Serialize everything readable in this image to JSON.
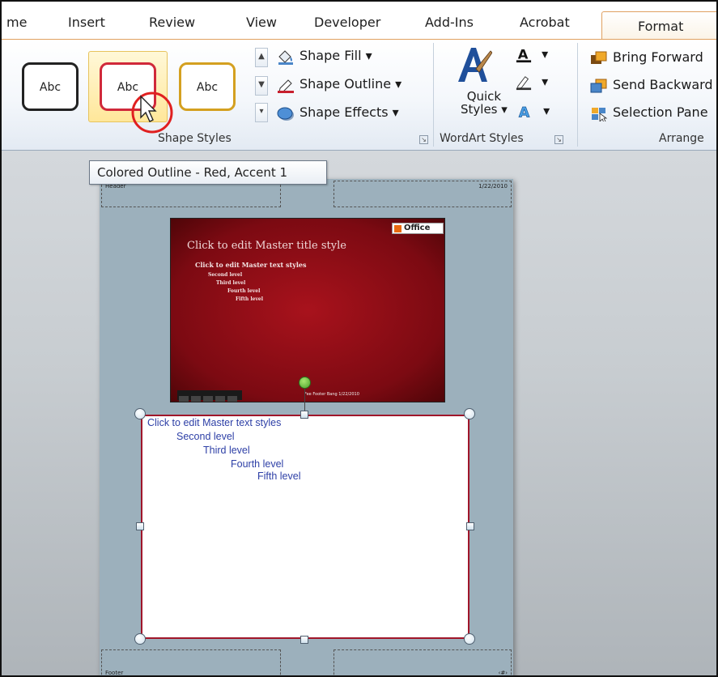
{
  "tabs": [
    {
      "label": "me"
    },
    {
      "label": "Insert"
    },
    {
      "label": "Review"
    },
    {
      "label": "View"
    },
    {
      "label": "Developer"
    },
    {
      "label": "Add-Ins"
    },
    {
      "label": "Acrobat"
    }
  ],
  "active_tab": {
    "label": "Format"
  },
  "shape_styles": {
    "group_label": "Shape Styles",
    "thumbnails": [
      {
        "label": "Abc",
        "outline_color": "#222222"
      },
      {
        "label": "Abc",
        "outline_color": "#d0293a"
      },
      {
        "label": "Abc",
        "outline_color": "#d4a020"
      }
    ],
    "hovered_index": 1,
    "fill_label": "Shape Fill",
    "outline_label": "Shape Outline",
    "effects_label": "Shape Effects"
  },
  "wordart_styles": {
    "group_label": "WordArt Styles",
    "quick_styles_label": "Quick",
    "quick_styles_label2": "Styles"
  },
  "arrange": {
    "group_label": "Arrange",
    "bring_forward_label": "Bring Forward",
    "send_backward_label": "Send Backward",
    "selection_pane_label": "Selection Pane"
  },
  "tooltip": {
    "text": "Colored Outline - Red, Accent 1"
  },
  "page": {
    "header_label": "Header",
    "date_label": "1/22/2010",
    "footer_label": "Footer",
    "page_num_label": "‹#›"
  },
  "slide": {
    "title": "Click to edit Master title style",
    "level1": "Click to edit Master text styles",
    "level2": "Second level",
    "level3": "Third level",
    "level4": "Fourth level",
    "level5": "Fifth level",
    "logo": "Office",
    "footer": "Fee Footer Bang   1/22/2010"
  },
  "notes": {
    "level1": "Click to edit Master text styles",
    "level2": "Second level",
    "level3": "Third level",
    "level4": "Fourth level",
    "level5": "Fifth level"
  },
  "colors": {
    "accent_red": "#d0293a",
    "annotation_circle": "#e02020",
    "notes_text": "#2d3fa6"
  },
  "icons": [
    "shape-fill-icon",
    "shape-outline-icon",
    "shape-effects-icon",
    "quick-styles-icon",
    "text-fill-icon",
    "text-outline-icon",
    "text-effects-icon",
    "bring-forward-icon",
    "send-backward-icon",
    "selection-pane-icon",
    "cursor-icon"
  ]
}
